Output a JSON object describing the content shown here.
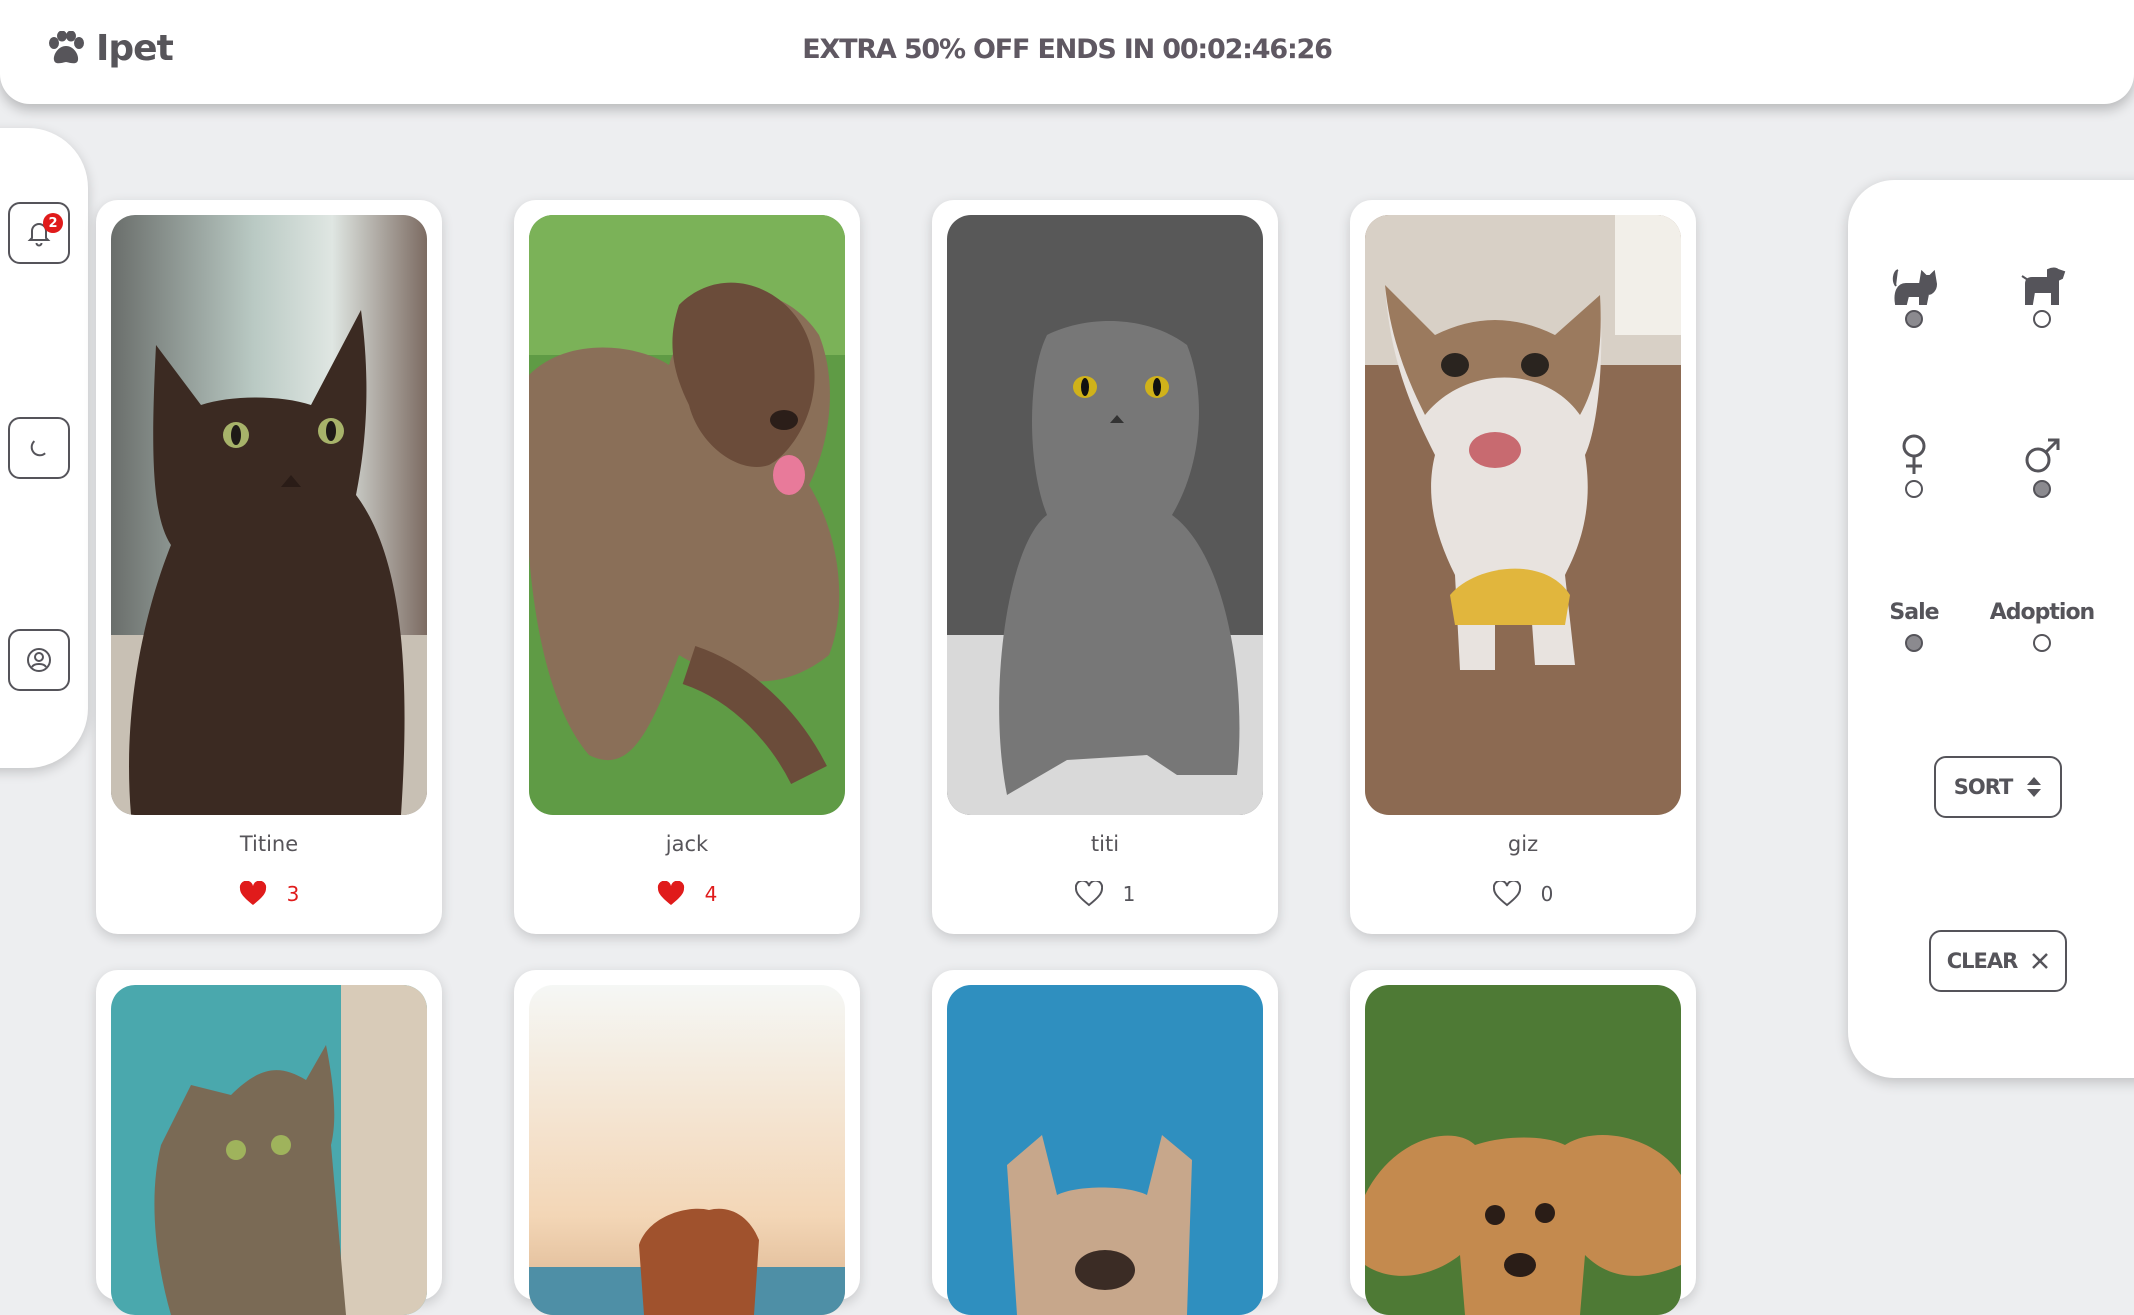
{
  "header": {
    "brand": "Ipet",
    "promo": "EXTRA 50% OFF ENDS IN 00:02:46:26"
  },
  "sidebar": {
    "notification_count": "2",
    "items": [
      {
        "name": "notifications",
        "icon": "bell-icon"
      },
      {
        "name": "dark-mode",
        "icon": "moon-icon"
      },
      {
        "name": "profile",
        "icon": "user-circle-icon"
      }
    ]
  },
  "pets": [
    {
      "name": "Titine",
      "likes": "3",
      "liked": true,
      "species": "cat"
    },
    {
      "name": "jack",
      "likes": "4",
      "liked": true,
      "species": "dog"
    },
    {
      "name": "titi",
      "likes": "1",
      "liked": false,
      "species": "cat"
    },
    {
      "name": "giz",
      "likes": "0",
      "liked": false,
      "species": "cat"
    },
    {
      "name": "",
      "likes": "",
      "liked": false,
      "species": "cat"
    },
    {
      "name": "",
      "likes": "",
      "liked": false,
      "species": "dog"
    },
    {
      "name": "",
      "likes": "",
      "liked": false,
      "species": "dog"
    },
    {
      "name": "",
      "likes": "",
      "liked": false,
      "species": "dog"
    }
  ],
  "filters": {
    "species": {
      "cat_selected": true,
      "dog_selected": false
    },
    "gender": {
      "female_selected": false,
      "male_selected": true
    },
    "listing": {
      "sale_label": "Sale",
      "sale_selected": true,
      "adoption_label": "Adoption",
      "adoption_selected": false
    },
    "sort_label": "SORT",
    "clear_label": "CLEAR"
  },
  "colors": {
    "accent": "#e01b1b",
    "text": "#55545a",
    "background": "#edeef0"
  }
}
